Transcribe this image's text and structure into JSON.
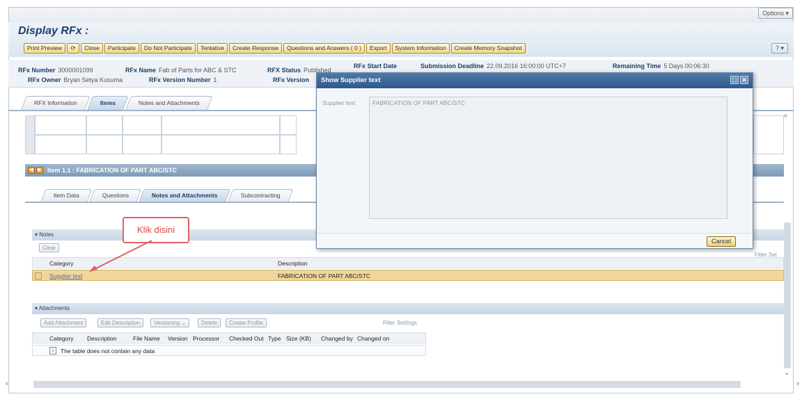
{
  "options_label": "Options",
  "page_title": "Display RFx :",
  "toolbar": {
    "buttons": [
      "Print Preview",
      "Close",
      "Participate",
      "Do Not Participate",
      "Tentative",
      "Create Response",
      "Questions and Answers ( 0 )",
      "Export",
      "System Information",
      "Create Memory Snapshot"
    ],
    "refresh_icon": "⟳",
    "help_icon": "?"
  },
  "info": {
    "rfx_number_label": "RFx Number",
    "rfx_number": "3000001099",
    "rfx_name_label": "RFx Name",
    "rfx_name": "Fab of Parts for ABC & STC",
    "rfx_status_label": "RFX Status",
    "rfx_status": "Published",
    "rfx_start_label": "RFx Start Date",
    "submission_label": "Submission Deadline",
    "submission_value": "22.09.2016 16:00:00 UTC+7",
    "remaining_label": "Remaining Time",
    "remaining_value": "5 Days 00:06:30",
    "owner_label": "RFx Owner",
    "owner": "Bryan Setya Kusuma",
    "version_number_label": "RFx Version Number",
    "version_number": "1",
    "version_label": "RFx Version"
  },
  "tabs_top": [
    "RFX Information",
    "Items",
    "Notes and Attachments"
  ],
  "item": {
    "title": "Item 1.1 : FABRICATION OF PART ABC/STC",
    "tabs": [
      "Item Data",
      "Questions",
      "Notes and Attachments",
      "Subcontracting"
    ]
  },
  "notes": {
    "header": "Notes",
    "clear_label": "Clear",
    "filter_label": "Filter Set",
    "col_category": "Category",
    "col_description": "Description",
    "row_category": "Supplier text",
    "row_description": "FABRICATION OF PART ABC/STC"
  },
  "attachments": {
    "header": "Attachments",
    "buttons": [
      "Add Attachment",
      "Edit Description",
      "Versioning",
      "Delete",
      "Create Profile"
    ],
    "filter_label": "Filter Settings",
    "columns": [
      "Category",
      "Description",
      "File Name",
      "Version",
      "Processor",
      "Checked Out",
      "Type",
      "Size (KB)",
      "Changed by",
      "Changed on"
    ],
    "empty_text": "The table does not contain any data"
  },
  "modal": {
    "title": "Show Supplier text",
    "label": "Supplier text",
    "text": "FABRICATION OF PART ABC/STC",
    "cancel": "Cancel"
  },
  "callout_text": "Klik disini"
}
